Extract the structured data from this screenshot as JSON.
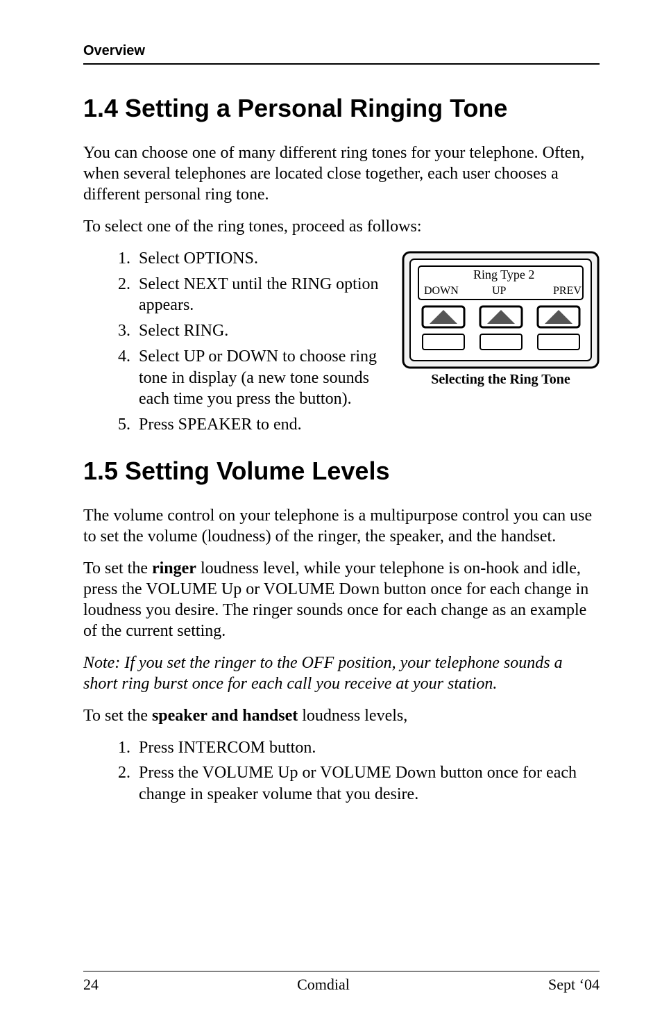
{
  "header": {
    "running": "Overview"
  },
  "sec14": {
    "title": "1.4  Setting a Personal Ringing Tone",
    "p1": "You can choose one of many different ring tones for your telephone. Often, when several telephones are located close together, each user chooses a different personal ring tone.",
    "p2": "To select one of the ring tones, proceed as follows:",
    "steps": {
      "s1": "Select OPTIONS.",
      "s2": "Select NEXT until the  RING option appears.",
      "s3": "Select RING.",
      "s4": "Select UP or  DOWN to choose ring tone in display (a new tone sounds each time you press the button).",
      "s5": "Press SPEAKER to end."
    },
    "figure": {
      "lcd_line1": "Ring Type 2",
      "softkeys": {
        "left": "DOWN",
        "mid": "UP",
        "right": "PREV"
      },
      "caption": "Selecting the Ring Tone"
    }
  },
  "sec15": {
    "title": "1.5  Setting Volume Levels",
    "p1": "The volume control on your telephone is a multipurpose control you can use to set the volume (loudness) of the ringer, the speaker, and the handset.",
    "p2a": "To set the ",
    "p2bold": "ringer",
    "p2b": " loudness level, while your telephone is on-hook and idle, press the VOLUME Up or VOLUME Down button once for each change in loudness you desire.  The ringer sounds once for each change as an example of the current setting.",
    "note": "Note: If you set the ringer to the OFF position, your telephone sounds a short ring burst once for each call you receive at your station.",
    "p3a": "To set the ",
    "p3bold": "speaker and handset",
    "p3b": " loudness levels,",
    "steps": {
      "s1": "Press INTERCOM button.",
      "s2": "Press the VOLUME Up or VOLUME Down button once for each change in speaker volume that you desire."
    }
  },
  "footer": {
    "page": "24",
    "center": "Comdial",
    "right": "Sept ‘04"
  }
}
